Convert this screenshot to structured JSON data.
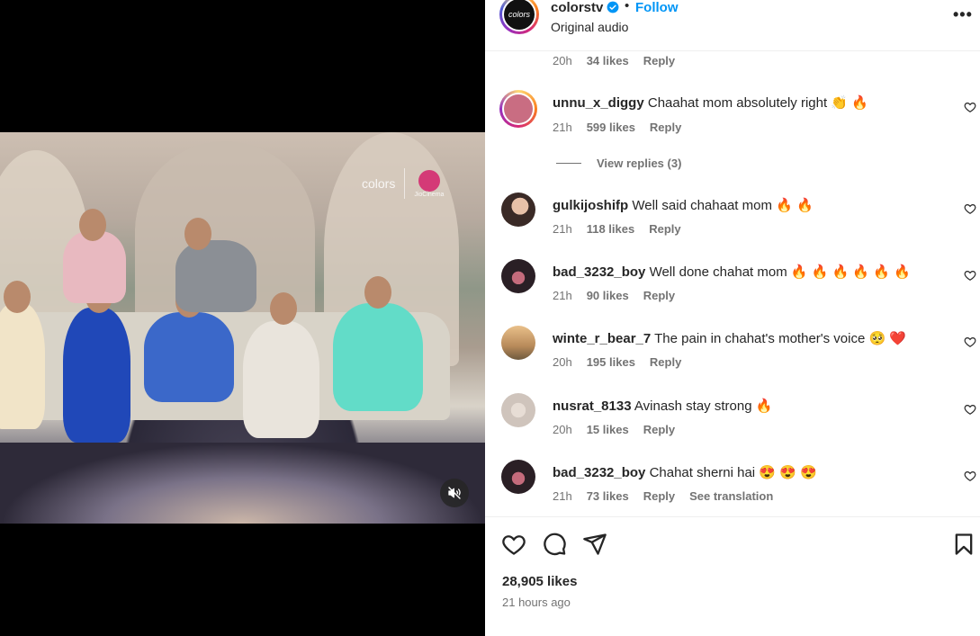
{
  "post": {
    "username": "colorstv",
    "avatar_text": "colors",
    "separator": "•",
    "follow_label": "Follow",
    "audio_label": "Original audio",
    "more_label": "•••",
    "video": {
      "watermark_brand": "colors",
      "watermark_partner": "JioCinema",
      "muted": true
    }
  },
  "comments": [
    {
      "username": "",
      "text": "",
      "time": "20h",
      "likes": "34 likes",
      "reply": "Reply",
      "extra": ""
    },
    {
      "username": "unnu_x_diggy",
      "text": "Chaahat mom absolutely right 👏 🔥",
      "time": "21h",
      "likes": "599 likes",
      "reply": "Reply",
      "extra": "",
      "view_replies": "View replies (3)"
    },
    {
      "username": "gulkijoshifp",
      "text": "Well said chahaat mom 🔥 🔥",
      "time": "21h",
      "likes": "118 likes",
      "reply": "Reply",
      "extra": ""
    },
    {
      "username": "bad_3232_boy",
      "text": "Well done chahat mom 🔥 🔥 🔥 🔥 🔥 🔥",
      "time": "21h",
      "likes": "90 likes",
      "reply": "Reply",
      "extra": ""
    },
    {
      "username": "winte_r_bear_7",
      "text": "The pain in chahat's mother's voice 🥺 ❤️",
      "time": "20h",
      "likes": "195 likes",
      "reply": "Reply",
      "extra": ""
    },
    {
      "username": "nusrat_8133",
      "text": "Avinash stay strong 🔥",
      "time": "20h",
      "likes": "15 likes",
      "reply": "Reply",
      "extra": ""
    },
    {
      "username": "bad_3232_boy",
      "text": "Chahat sherni hai 😍 😍 😍",
      "time": "21h",
      "likes": "73 likes",
      "reply": "Reply",
      "extra": "See translation"
    }
  ],
  "footer": {
    "likes_total": "28,905 likes",
    "posted_ago": "21 hours ago"
  },
  "colors": {
    "follow": "#0095f6",
    "meta": "#737373",
    "text": "#262626"
  }
}
